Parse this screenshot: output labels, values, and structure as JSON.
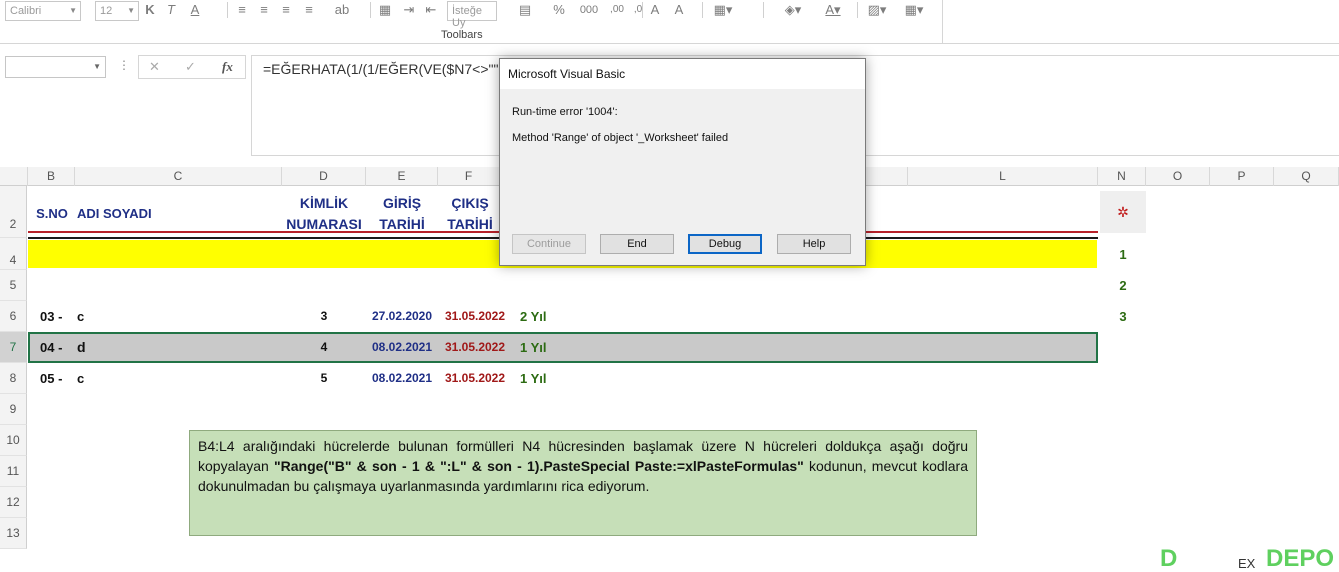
{
  "toolbar": {
    "font_name": "Calibri",
    "font_size": "12",
    "align_option": "İsteğe Uy",
    "caption": "Toolbars"
  },
  "formula_bar": {
    "name_box": "",
    "cancel_glyph": "✕",
    "enter_glyph": "✓",
    "fx_label": "fx",
    "formula": "=EĞERHATA(1/(1/EĞER(VE($N7<>\"\";$N"
  },
  "columns": [
    "B",
    "C",
    "D",
    "E",
    "F",
    "L",
    "N",
    "O",
    "P",
    "Q"
  ],
  "rows": [
    "2",
    "4",
    "5",
    "6",
    "7",
    "8",
    "9",
    "10",
    "11",
    "12",
    "13"
  ],
  "headers": {
    "sno": "S.NO",
    "adi": "ADI SOYADI",
    "kimlik_1": "KİMLİK",
    "kimlik_2": "NUMARASI",
    "giris_1": "GİRİŞ",
    "giris_2": "TARİHİ",
    "cikis_1": "ÇIKIŞ",
    "cikis_2": "TARİHİ"
  },
  "data_rows": [
    {
      "no": "03 -",
      "name": "c",
      "kimlik": "3",
      "giris": "27.02.2020",
      "cikis": "31.05.2022",
      "sure": "2 Yıl"
    },
    {
      "no": "04 -",
      "name": "d",
      "kimlik": "4",
      "giris": "08.02.2021",
      "cikis": "31.05.2022",
      "sure": "1 Yıl"
    },
    {
      "no": "05 -",
      "name": "c",
      "kimlik": "5",
      "giris": "08.02.2021",
      "cikis": "31.05.2022",
      "sure": "1 Yıl"
    }
  ],
  "n_values": [
    "1",
    "2",
    "3"
  ],
  "note": {
    "part1": "B4:L4 aralığındaki hücrelerde bulunan formülleri N4 hücresinden başlamak üzere N hücreleri doldukça aşağı doğru kopyalayan ",
    "code": "\"Range(\"B\" & son - 1 & \":L\" & son - 1).PasteSpecial Paste:=xlPasteFormulas\"",
    "part2": " kodunun, mevcut kodlara dokunulmadan bu çalışmaya uyarlanmasında yardımlarını rica ediyorum."
  },
  "dialog": {
    "title": "Microsoft Visual Basic",
    "error": "Run-time error '1004':",
    "message": "Method 'Range' of object '_Worksheet' failed",
    "buttons": {
      "continue": "Continue",
      "end": "End",
      "debug": "Debug",
      "help": "Help"
    }
  },
  "watermark": {
    "left": "D",
    "right": "DEPO",
    "small": "EX"
  }
}
